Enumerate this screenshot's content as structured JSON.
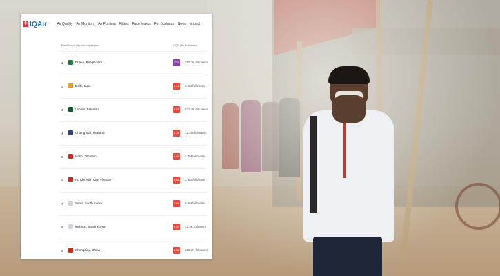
{
  "nav": {
    "logo_mark": "✚",
    "logo_text": "IQAir",
    "menu": [
      "Air Quality",
      "Air Monitors",
      "Air Purifiers",
      "Filters",
      "Face Masks",
      "For Business",
      "News",
      "Impact"
    ]
  },
  "table": {
    "headers": {
      "rank": "Rank",
      "city": "Major city, country/region",
      "aqi": "AQI⁺ US",
      "followers": "Followers"
    },
    "rows": [
      {
        "rank": "1",
        "city": "Dhaka, Bangladesh",
        "aqi": "239",
        "aqi_color": "#8e44ad",
        "followers": "269.3K followers",
        "flag_color": "#1b7a3a"
      },
      {
        "rank": "2",
        "city": "Delhi, India",
        "aqi": "194",
        "aqi_color": "#e74c3c",
        "followers": "2.8M followers",
        "flag_color": "#f39c12"
      },
      {
        "rank": "3",
        "city": "Lahore, Pakistan",
        "aqi": "183",
        "aqi_color": "#e74c3c",
        "followers": "521.4K followers",
        "flag_color": "#0b5d2b"
      },
      {
        "rank": "4",
        "city": "Chiang Mai, Thailand",
        "aqi": "176",
        "aqi_color": "#e74c3c",
        "followers": "12.4M followers",
        "flag_color": "#2c3e8f"
      },
      {
        "rank": "5",
        "city": "Hanoi, Vietnam",
        "aqi": "168",
        "aqi_color": "#e74c3c",
        "followers": "2.7M followers",
        "flag_color": "#da251d"
      },
      {
        "rank": "6",
        "city": "Ho Chi Minh City, Vietnam",
        "aqi": "163",
        "aqi_color": "#e74c3c",
        "followers": "2.9M followers",
        "flag_color": "#da251d"
      },
      {
        "rank": "7",
        "city": "Seoul, South Korea",
        "aqi": "156",
        "aqi_color": "#e74c3c",
        "followers": "8.3M followers",
        "flag_color": "#cfd4db"
      },
      {
        "rank": "8",
        "city": "Incheon, South Korea",
        "aqi": "155",
        "aqi_color": "#e74c3c",
        "followers": "37.3K followers",
        "flag_color": "#cfd4db"
      },
      {
        "rank": "9",
        "city": "Chongqing, China",
        "aqi": "155",
        "aqi_color": "#e74c3c",
        "followers": "228.3K followers",
        "flag_color": "#de2910"
      }
    ]
  }
}
